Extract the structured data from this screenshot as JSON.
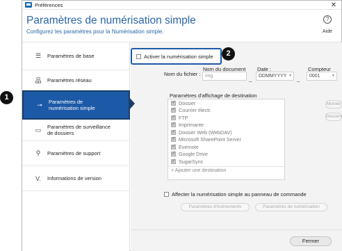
{
  "window": {
    "title": "Préférences",
    "close_glyph": "✕"
  },
  "header": {
    "title": "Paramètres de numérisation simple",
    "subtitle": "Configurez les paramètres pour la Numérisation simple.",
    "help_label": "Aide",
    "help_glyph": "?"
  },
  "sidebar": {
    "items": [
      {
        "label": "Paramètres de base",
        "icon": "list-icon",
        "glyph": "☰"
      },
      {
        "label": "Paramètres réseau",
        "icon": "network-icon",
        "glyph": "品"
      },
      {
        "label": "Paramètres de numérisation simple",
        "icon": "key-toggle-icon",
        "glyph": "⊸",
        "selected": true
      },
      {
        "label": "Paramètres de surveillance de dossiers",
        "icon": "folder-icon",
        "glyph": "▭"
      },
      {
        "label": "Paramètres de support",
        "icon": "support-icon",
        "glyph": "⚲"
      },
      {
        "label": "Informations de version",
        "icon": "check-icon",
        "glyph": "V."
      }
    ]
  },
  "main": {
    "enable_label": "Activer la numérisation simple",
    "file_name": {
      "label": "Nom du fichier :",
      "doc_name_label": "Nom du document",
      "doc_name_value": "img",
      "date_label": "Date :",
      "date_value": "DDMMYYYY",
      "counter_label": "Compteur",
      "counter_value": "0001",
      "separator": "_"
    },
    "destinations": {
      "title": "Paramètres d'affichage de destination",
      "items": [
        "Dossier",
        "Courrier électr.",
        "FTP",
        "Imprimante",
        "Dossier Web (WebDAV)",
        "Microsoft SharePoint Server",
        "Evernote",
        "Google Drive",
        "SugarSync"
      ],
      "add_label": "+ Ajouter une destination",
      "up_label": "Monter",
      "down_label": "Descendre"
    },
    "assign_label": "Affecter la numérisation simple au panneau de commande",
    "event_settings_label": "Paramètres d'évènements",
    "scan_settings_label": "Paramètres de numérisation",
    "close_label": "Fermer"
  },
  "callouts": {
    "one": "1",
    "two": "2"
  },
  "colors": {
    "accent": "#1c5aa8",
    "title_blue": "#2b66a8",
    "callout": "#111111"
  }
}
